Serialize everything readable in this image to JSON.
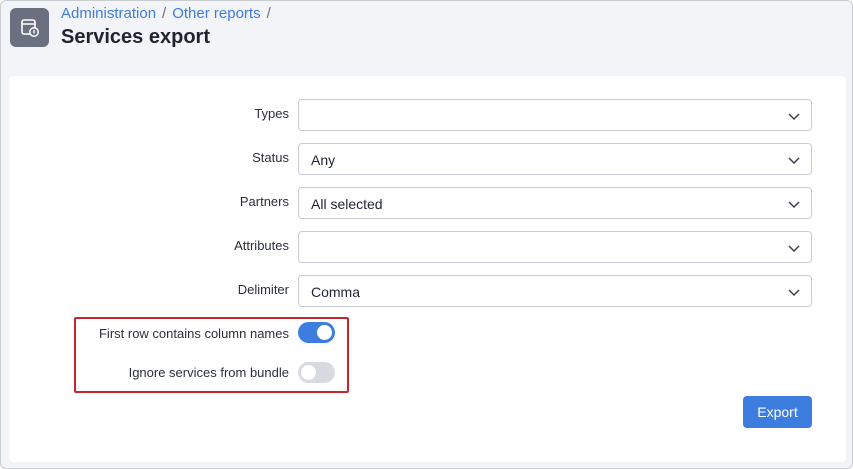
{
  "breadcrumb": {
    "items": [
      "Administration",
      "Other reports"
    ],
    "separator": "/"
  },
  "page": {
    "title": "Services export"
  },
  "form": {
    "types": {
      "label": "Types",
      "value": ""
    },
    "status": {
      "label": "Status",
      "value": "Any"
    },
    "partners": {
      "label": "Partners",
      "value": "All selected"
    },
    "attributes": {
      "label": "Attributes",
      "value": ""
    },
    "delimiter": {
      "label": "Delimiter",
      "value": "Comma"
    },
    "first_row": {
      "label": "First row contains column names",
      "enabled": true
    },
    "ignore_bundle": {
      "label": "Ignore services from bundle",
      "enabled": false
    },
    "export_label": "Export"
  },
  "colors": {
    "accent": "#3d7de0",
    "highlight_border": "#c8262e"
  },
  "icons": {
    "app": "report-document-icon",
    "select": "chevron-down-icon"
  }
}
